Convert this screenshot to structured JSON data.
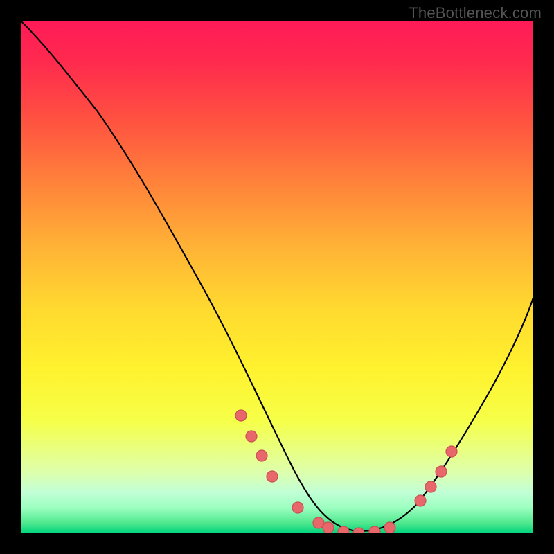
{
  "watermark": "TheBottleneck.com",
  "chart_data": {
    "type": "line",
    "title": "",
    "xlabel": "",
    "ylabel": "",
    "xlim": [
      0,
      100
    ],
    "ylim": [
      0,
      100
    ],
    "grid": false,
    "series": [
      {
        "name": "curve",
        "x": [
          0,
          6,
          12,
          18,
          24,
          30,
          36,
          42,
          49,
          54,
          58,
          62,
          66,
          70,
          75,
          80,
          86,
          92,
          100
        ],
        "y": [
          100,
          93,
          85,
          77,
          69,
          60,
          50,
          39,
          24,
          13,
          6,
          2,
          0,
          0,
          3,
          9,
          18,
          29,
          47
        ]
      }
    ],
    "scatter_points": {
      "x": [
        43,
        45,
        47,
        49,
        54,
        58,
        60,
        63,
        66,
        69,
        72,
        78,
        80,
        82,
        84
      ],
      "y": [
        23,
        19,
        15,
        11,
        5,
        2,
        1,
        0,
        0,
        0,
        1,
        6,
        9,
        12,
        16
      ]
    },
    "colors": {
      "gradient_top": "#ff1a57",
      "gradient_mid": "#ffd92f",
      "gradient_bottom": "#00d47c",
      "curve": "#000000",
      "dots": "#e8676b",
      "page_bg": "#000000"
    }
  }
}
